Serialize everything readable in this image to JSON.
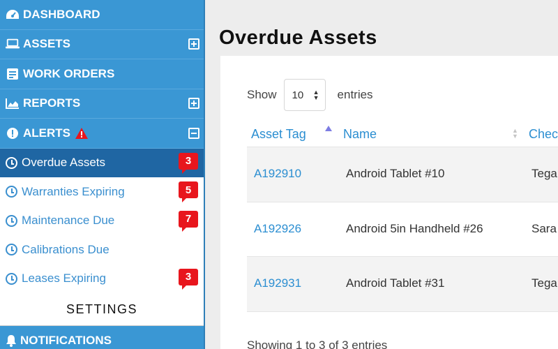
{
  "sidebar": {
    "dashboard": "DASHBOARD",
    "assets": "ASSETS",
    "work_orders": "WORK ORDERS",
    "reports": "REPORTS",
    "alerts": "ALERTS",
    "sub_items": [
      {
        "label": "Overdue Assets",
        "badge": "3"
      },
      {
        "label": "Warranties Expiring",
        "badge": "5"
      },
      {
        "label": "Maintenance Due",
        "badge": "7"
      },
      {
        "label": "Calibrations Due",
        "badge": ""
      },
      {
        "label": "Leases Expiring",
        "badge": "3"
      }
    ],
    "settings": "SETTINGS",
    "notifications": "NOTIFICATIONS"
  },
  "main": {
    "title": "Overdue Assets",
    "show_label": "Show",
    "page_size": "10",
    "entries_label": "entries",
    "columns": [
      "Asset Tag",
      "Name",
      "Chec"
    ],
    "rows": [
      {
        "tag": "A192910",
        "name": "Android Tablet #10",
        "checked": "Tega"
      },
      {
        "tag": "A192926",
        "name": "Android 5in Handheld #26",
        "checked": "Sara"
      },
      {
        "tag": "A192931",
        "name": "Android Tablet #31",
        "checked": "Tega"
      }
    ],
    "footer": "Showing 1 to 3 of 3 entries"
  },
  "colors": {
    "sidebar": "#3a97d4",
    "active_item": "#1f66a3",
    "link": "#2b8ed1",
    "badge": "#e8161d"
  }
}
